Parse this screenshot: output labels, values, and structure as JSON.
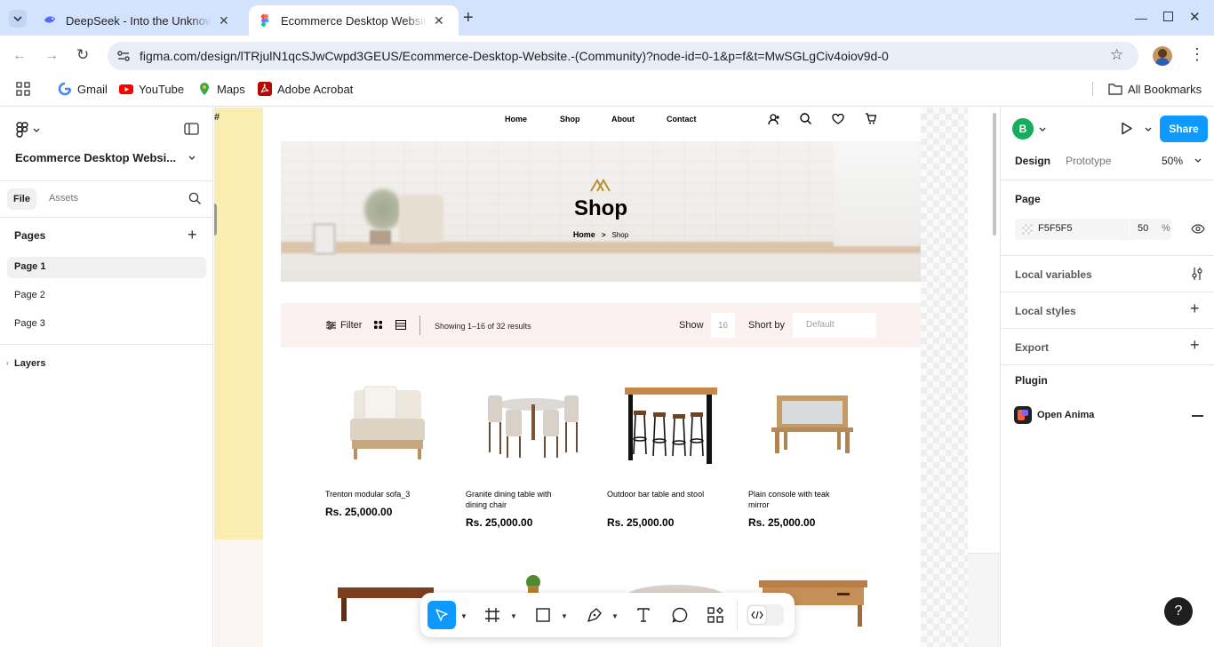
{
  "browser": {
    "tabs": [
      {
        "title": "DeepSeek - Into the Unknown",
        "active": false
      },
      {
        "title": "Ecommerce Desktop Website",
        "active": true
      }
    ],
    "url": "figma.com/design/lTRjulN1qcSJwCwpd3GEUS/Ecommerce-Desktop-Website.-(Community)?node-id=0-1&p=f&t=MwSGLgCiv4oiov9d-0",
    "bookmarks": [
      "Gmail",
      "YouTube",
      "Maps",
      "Adobe Acrobat"
    ],
    "all_bookmarks": "All Bookmarks"
  },
  "left_panel": {
    "file_name": "Ecommerce Desktop Websi...",
    "tabs": [
      "File",
      "Assets"
    ],
    "pages_label": "Pages",
    "pages": [
      "Page 1",
      "Page 2",
      "Page 3"
    ],
    "layers_label": "Layers"
  },
  "right_panel": {
    "avatar_letter": "B",
    "share_label": "Share",
    "tabs": [
      "Design",
      "Prototype"
    ],
    "zoom": "50%",
    "page_label": "Page",
    "page_color": "F5F5F5",
    "page_opacity": "50",
    "percent_sign": "%",
    "local_variables": "Local variables",
    "local_styles": "Local styles",
    "export": "Export",
    "plugin_label": "Plugin",
    "plugin_name": "Open Anima",
    "help": "?"
  },
  "design": {
    "nav": [
      "Home",
      "Shop",
      "About",
      "Contact"
    ],
    "hero_title": "Shop",
    "breadcrumb_home": "Home",
    "breadcrumb_sep": ">",
    "breadcrumb_current": "Shop",
    "filter_label": "Filter",
    "results_text": "Showing 1–16 of 32 results",
    "show_label": "Show",
    "show_value": "16",
    "sort_label": "Short by",
    "sort_value": "Default",
    "products": [
      {
        "name": "Trenton modular sofa_3",
        "price": "Rs. 25,000.00"
      },
      {
        "name": "Granite dining table with dining chair",
        "price": "Rs. 25,000.00"
      },
      {
        "name": "Outdoor bar table and stool",
        "price": "Rs. 25,000.00"
      },
      {
        "name": "Plain console with teak mirror",
        "price": "Rs. 25,000.00"
      }
    ]
  },
  "colors": {
    "figma_blue": "#0d99ff",
    "share_green": "#14ae5c",
    "filter_bar": "#f9f1e7",
    "left_frame_yellow": "#f9eeb0"
  }
}
